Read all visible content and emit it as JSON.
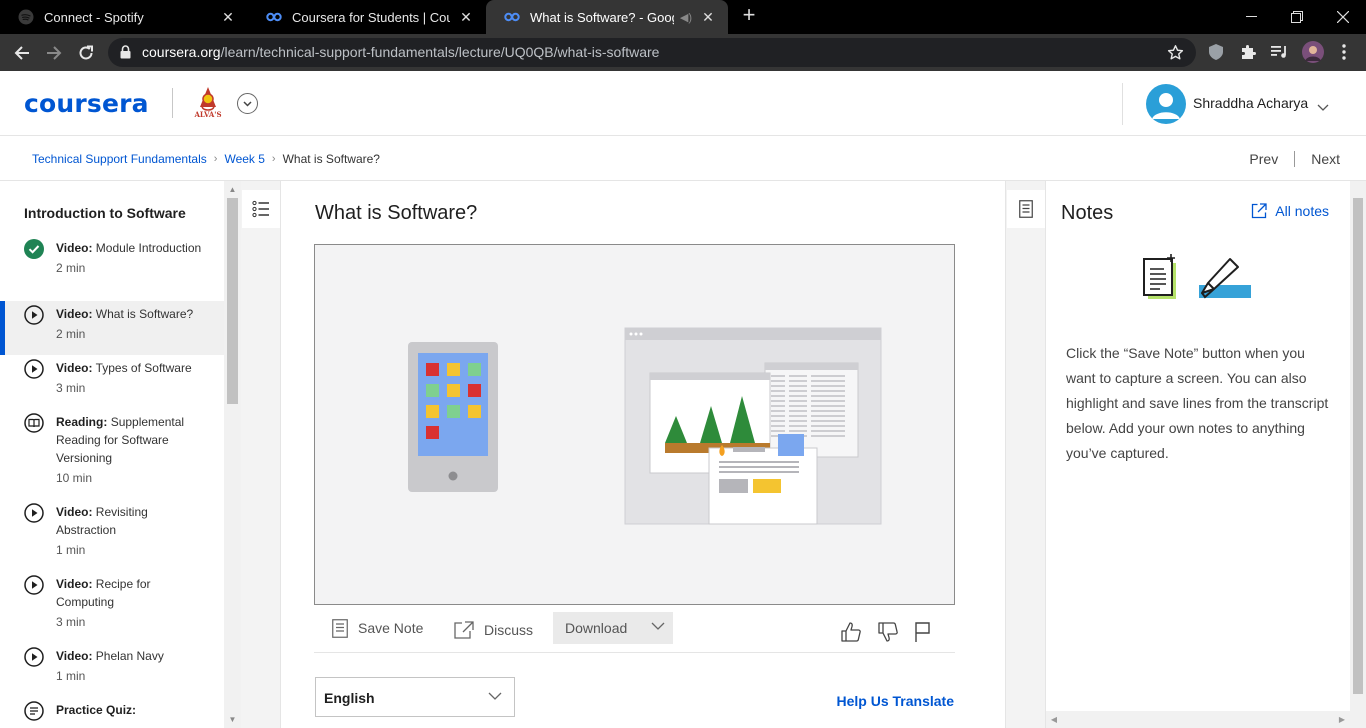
{
  "browser": {
    "tabs": [
      {
        "title": "Connect - Spotify",
        "active": false
      },
      {
        "title": "Coursera for Students | Coursera",
        "active": false
      },
      {
        "title": "What is Software? - Google |",
        "active": true
      }
    ],
    "url_domain": "coursera.org",
    "url_path": "/learn/technical-support-fundamentals/lecture/UQ0QB/what-is-software"
  },
  "header": {
    "logo": "coursera",
    "org_name": "ALVA'S",
    "user_name": "Shraddha Acharya"
  },
  "breadcrumb": {
    "items": [
      "Technical Support Fundamentals",
      "Week 5",
      "What is Software?"
    ],
    "prev": "Prev",
    "next": "Next"
  },
  "sidebar": {
    "title": "Introduction to Software",
    "items": [
      {
        "type": "Video:",
        "title": "Module Introduction",
        "duration": "2 min",
        "icon": "check-circle-icon"
      },
      {
        "type": "Video:",
        "title": "What is Software?",
        "duration": "2 min",
        "icon": "play-circle-icon"
      },
      {
        "type": "Video:",
        "title": "Types of Software",
        "duration": "3 min",
        "icon": "play-circle-icon"
      },
      {
        "type": "Reading:",
        "title": "Supplemental Reading for Software Versioning",
        "duration": "10 min",
        "icon": "book-icon"
      },
      {
        "type": "Video:",
        "title": "Revisiting Abstraction",
        "duration": "1 min",
        "icon": "play-circle-icon"
      },
      {
        "type": "Video:",
        "title": "Recipe for Computing",
        "duration": "3 min",
        "icon": "play-circle-icon"
      },
      {
        "type": "Video:",
        "title": "Phelan Navy",
        "duration": "1 min",
        "icon": "play-circle-icon"
      },
      {
        "type": "Practice Quiz:",
        "title": "",
        "duration": "",
        "icon": "quiz-icon"
      }
    ]
  },
  "main": {
    "lecture_title": "What is Software?",
    "save_note": "Save Note",
    "discuss": "Discuss",
    "download": "Download",
    "language": "English",
    "help_translate": "Help Us Translate"
  },
  "notes": {
    "title": "Notes",
    "all_notes": "All notes",
    "description": "Click the “Save Note” button when you want to capture a screen. You can also highlight and save lines from the transcript below. Add your own notes to anything you’ve captured."
  }
}
